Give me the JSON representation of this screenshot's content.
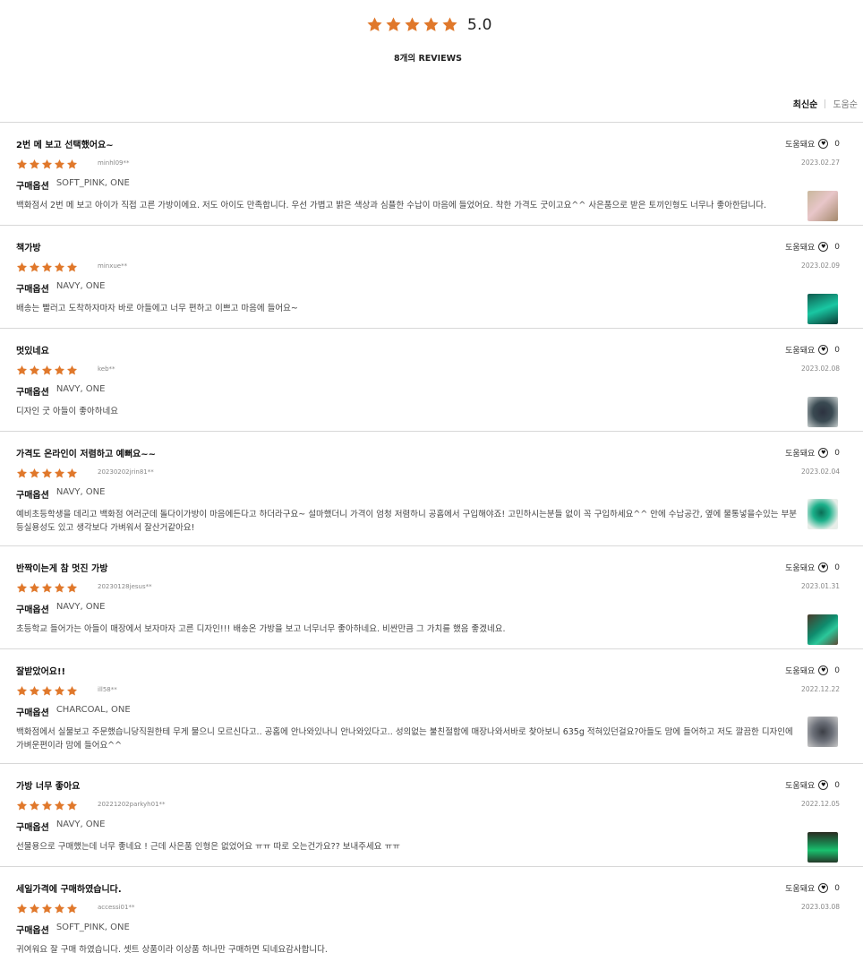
{
  "summary": {
    "score": "5.0",
    "count_label": "8개의 REVIEWS",
    "star_color": "#e0782b"
  },
  "sort": {
    "options": [
      "최신순",
      "도움순"
    ],
    "active": "최신순"
  },
  "helpful_label": "도움돼요",
  "option_label": "구매옵션",
  "reviews": [
    {
      "title": "2번 메 보고 선택했어요~",
      "user": "minhl09**",
      "option": "SOFT_PINK, ONE",
      "body": "백화점서 2번 메 보고 아이가 직접 고른 가방이에요. 저도 아이도 만족합니다. 우선 가볍고 밝은 색상과 심플한 수납이 마음에 들었어요. 착한 가격도 굿이고요^^ 사은품으로 받은 토끼인형도 너무나 좋아한답니다.",
      "date": "2023.02.27",
      "helpful": "0",
      "rating": 5,
      "thumb": "pink-bag-photo"
    },
    {
      "title": "책가방",
      "user": "minxue**",
      "option": "NAVY, ONE",
      "body": "배송는 빨러고 도착하자마자 바로 아들에고 너무 편하고 이쁘고 마음에 들어요~",
      "date": "2023.02.09",
      "helpful": "0",
      "rating": 5,
      "thumb": "green-bag-photo"
    },
    {
      "title": "멋있네요",
      "user": "keb**",
      "option": "NAVY, ONE",
      "body": "디자인 굿 아들이 좋아하네요",
      "date": "2023.02.08",
      "helpful": "0",
      "rating": 5,
      "thumb": "navy-bag-photo"
    },
    {
      "title": "가격도 온라인이 저렴하고 예뻐요~~",
      "user": "20230202jrin81**",
      "option": "NAVY, ONE",
      "body": "예비초등학생을 데리고 백화점 여러군데 돌다이가방이 마음에든다고 하더라구요~ 설마했더니 가격이 엄청 저렴하니 공홈에서 구입해야죠! 고민하시는분들 없이 꼭 구입하세요^^ 안에 수납공간, 옆에 물통넣을수있는 부분 등실용성도 있고 생각보다 가벼워서 잘산거같아요!",
      "date": "2023.02.04",
      "helpful": "0",
      "rating": 5,
      "thumb": "teal-bag-photo"
    },
    {
      "title": "반짝이는게 참 멋진 가방",
      "user": "20230128jesus**",
      "option": "NAVY, ONE",
      "body": "초등학교 들어가는 아들이 매장에서 보자마자 고른 디자인!!! 배송온 가방을 보고 너무너무 좋아하네요. 비싼만큼 그 가치를 했음 좋겠네요.",
      "date": "2023.01.31",
      "helpful": "0",
      "rating": 5,
      "thumb": "shiny-bag-photo"
    },
    {
      "title": "잘받았어요!!",
      "user": "ill58**",
      "option": "CHARCOAL, ONE",
      "body": "백화점에서 실물보고 주문했습니당직원한테 무게 물으니 모르신다고.. 공홈에 안나와있나니 안나와있다고.. 성의없는 불친절함에 매장나와서바로 찾아보니 635g 적혀있던걸요?아들도 맘에 들어하고 저도 깔끔한 디자인에 가벼운편이라 맘에 들어요^^",
      "date": "2022.12.22",
      "helpful": "0",
      "rating": 5,
      "thumb": "charcoal-bag-photo"
    },
    {
      "title": "가방 너무 좋아요",
      "user": "20221202parkyh01**",
      "option": "NAVY, ONE",
      "body": "선물용으로 구매했는데 너무 좋네요 ! 근데 사은품 인형은 없었어요 ㅠㅠ 따로 오는건가요?? 보내주세요 ㅠㅠ",
      "date": "2022.12.05",
      "helpful": "0",
      "rating": 5,
      "thumb": "green-backpack-photo"
    },
    {
      "title": "세일가격에 구매하였습니다.",
      "user": "accessi01**",
      "option": "SOFT_PINK, ONE",
      "body": "귀여워요 잘 구매 하였습니다. 셋트 상품이라 이상품 하나만 구매하면 되네요감사합니다.",
      "date": "2023.03.08",
      "helpful": "0",
      "rating": 5,
      "thumb": ""
    }
  ]
}
